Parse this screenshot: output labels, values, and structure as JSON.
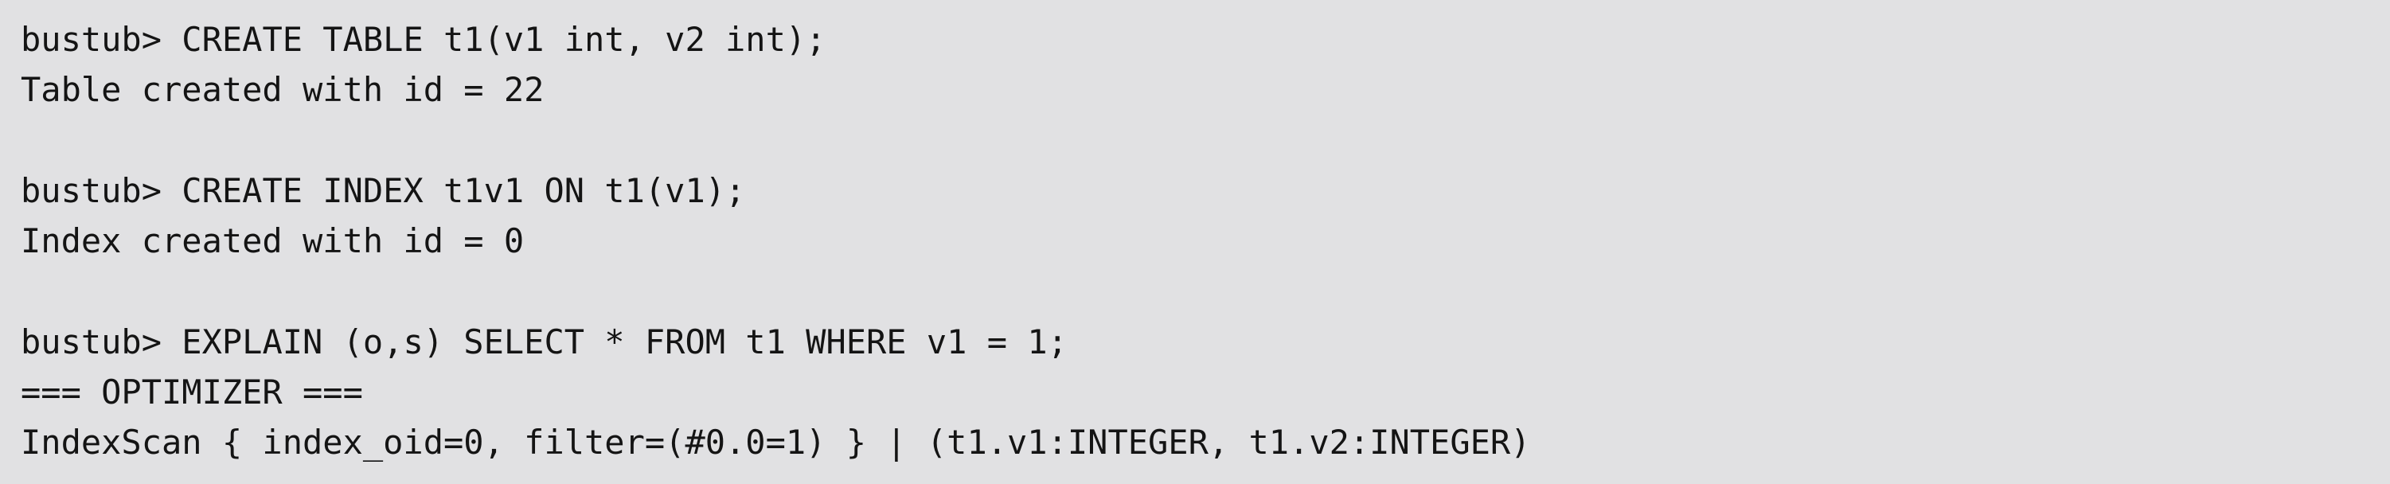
{
  "terminal": {
    "prompt": "bustub> ",
    "lines": [
      {
        "kind": "command",
        "text": "CREATE TABLE t1(v1 int, v2 int);"
      },
      {
        "kind": "output",
        "text": "Table created with id = 22"
      },
      {
        "kind": "blank",
        "text": ""
      },
      {
        "kind": "command",
        "text": "CREATE INDEX t1v1 ON t1(v1);"
      },
      {
        "kind": "output",
        "text": "Index created with id = 0"
      },
      {
        "kind": "blank",
        "text": ""
      },
      {
        "kind": "command",
        "text": "EXPLAIN (o,s) SELECT * FROM t1 WHERE v1 = 1;"
      },
      {
        "kind": "output",
        "text": "=== OPTIMIZER ==="
      },
      {
        "kind": "output",
        "text": "IndexScan { index_oid=0, filter=(#0.0=1) } | (t1.v1:INTEGER, t1.v2:INTEGER)"
      }
    ]
  }
}
